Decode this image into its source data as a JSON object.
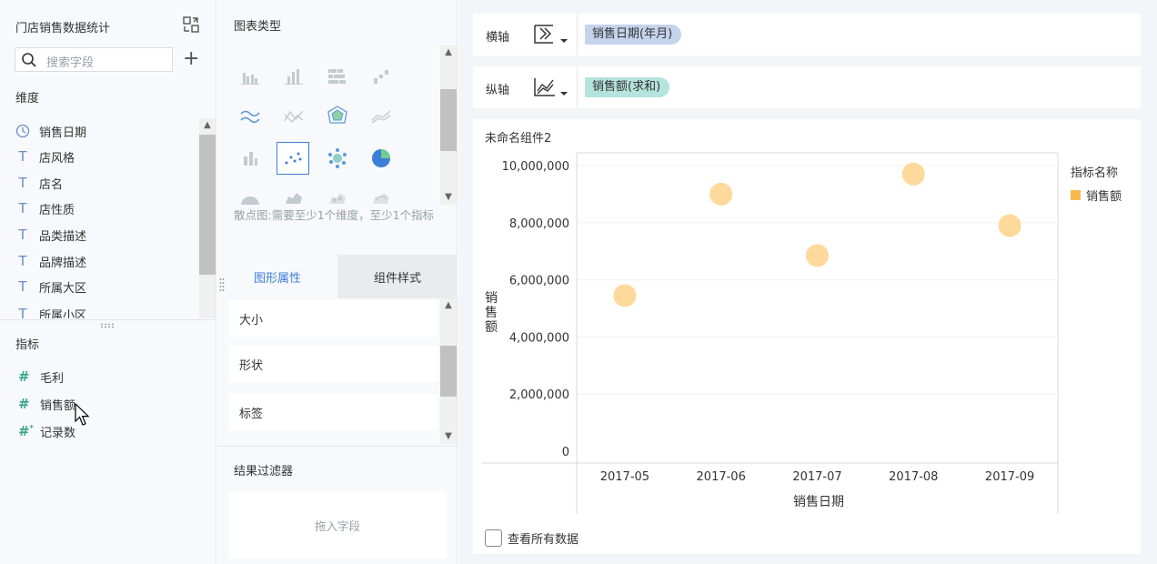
{
  "left_panel": {
    "title": "门店销售数据统计",
    "search_placeholder": "搜索字段",
    "dimensions_label": "维度",
    "dimensions": [
      {
        "label": "销售日期",
        "icon": "clock-icon"
      },
      {
        "label": "店风格",
        "icon": "text-field-icon"
      },
      {
        "label": "店名",
        "icon": "text-field-icon"
      },
      {
        "label": "店性质",
        "icon": "text-field-icon"
      },
      {
        "label": "品类描述",
        "icon": "text-field-icon"
      },
      {
        "label": "品牌描述",
        "icon": "text-field-icon"
      },
      {
        "label": "所属大区",
        "icon": "text-field-icon"
      },
      {
        "label": "所属小区",
        "icon": "text-field-icon"
      }
    ],
    "measures_label": "指标",
    "measures": [
      {
        "label": "毛利",
        "icon": "hash-icon"
      },
      {
        "label": "销售额",
        "icon": "hash-icon"
      },
      {
        "label": "记录数",
        "icon": "hash-star-icon"
      }
    ]
  },
  "middle_panel": {
    "chart_type_label": "图表类型",
    "chart_type_hint": "散点图:需要至少1个维度，至少1个指标",
    "tabs": {
      "shape_props": "图形属性",
      "component_style": "组件样式"
    },
    "props": [
      "大小",
      "形状",
      "标签"
    ],
    "filter_label": "结果过滤器",
    "filter_placeholder": "拖入字段"
  },
  "axes": {
    "x_label": "横轴",
    "x_field": "销售日期(年月)",
    "y_label": "纵轴",
    "y_field": "销售额(求和)"
  },
  "chart_card": {
    "title": "未命名组件2",
    "view_all_label": "查看所有数据"
  },
  "chart_data": {
    "type": "scatter",
    "title": "未命名组件2",
    "xlabel": "销售日期",
    "ylabel": "销售额",
    "categories": [
      "2017-05",
      "2017-06",
      "2017-07",
      "2017-08",
      "2017-09"
    ],
    "series": [
      {
        "name": "销售额",
        "values": [
          5450000,
          9000000,
          6850000,
          9700000,
          7900000
        ]
      }
    ],
    "ylim": [
      0,
      10000000
    ],
    "y_ticks": [
      "0",
      "2,000,000",
      "4,000,000",
      "6,000,000",
      "8,000,000",
      "10,000,000"
    ],
    "legend_title": "指标名称",
    "legend_position": "right",
    "grid": true,
    "point_color": "#fdd99b",
    "legend_color": "#f7b84d"
  },
  "colors": {
    "accent": "#3d7fd8",
    "x_pill": "#c5d3ec",
    "y_pill": "#b5e3de"
  }
}
